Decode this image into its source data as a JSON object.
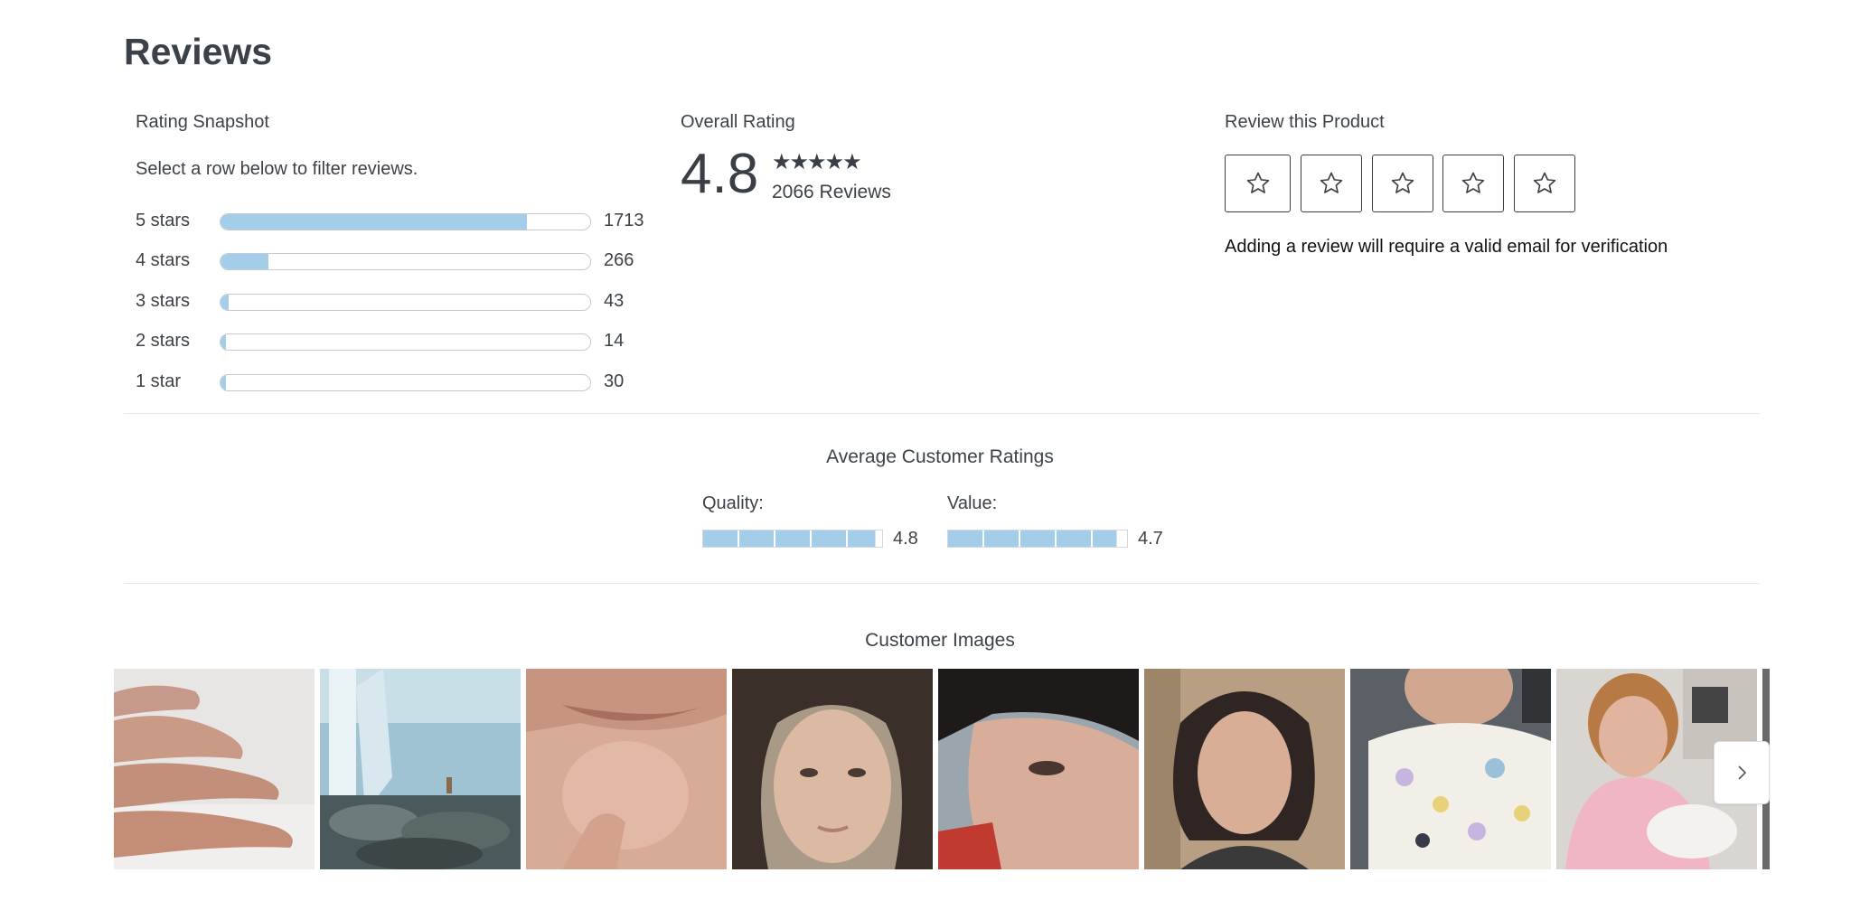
{
  "page": {
    "title": "Reviews"
  },
  "snapshot": {
    "heading": "Rating Snapshot",
    "instruction": "Select a row below to filter reviews.",
    "rows": [
      {
        "label": "5 stars",
        "count": "1713",
        "fraction": 0.83
      },
      {
        "label": "4 stars",
        "count": "266",
        "fraction": 0.13
      },
      {
        "label": "3 stars",
        "count": "43",
        "fraction": 0.021
      },
      {
        "label": "2 stars",
        "count": "14",
        "fraction": 0.007
      },
      {
        "label": "1 star",
        "count": "30",
        "fraction": 0.015
      }
    ]
  },
  "overall": {
    "heading": "Overall Rating",
    "value": "4.8",
    "stars": "★★★★★",
    "reviews": "2066 Reviews"
  },
  "review_product": {
    "heading": "Review this Product",
    "star_icon": "star-outline-icon",
    "verify_note": "Adding a review will require a valid email for verification"
  },
  "average": {
    "heading": "Average Customer Ratings",
    "attributes": [
      {
        "label": "Quality:",
        "value": "4.8",
        "score": 4.8
      },
      {
        "label": "Value:",
        "value": "4.7",
        "score": 4.7
      }
    ]
  },
  "customer_images": {
    "heading": "Customer Images",
    "next_icon": "chevron-right-icon",
    "images": [
      "photo-hand",
      "photo-waterfall",
      "photo-chin",
      "photo-face-1",
      "photo-face-2",
      "photo-face-3",
      "photo-floral-blouse",
      "photo-grandmother-baby",
      "photo-partial"
    ]
  },
  "colors": {
    "bar_fill": "#a3cde9",
    "text": "#3d4248"
  }
}
